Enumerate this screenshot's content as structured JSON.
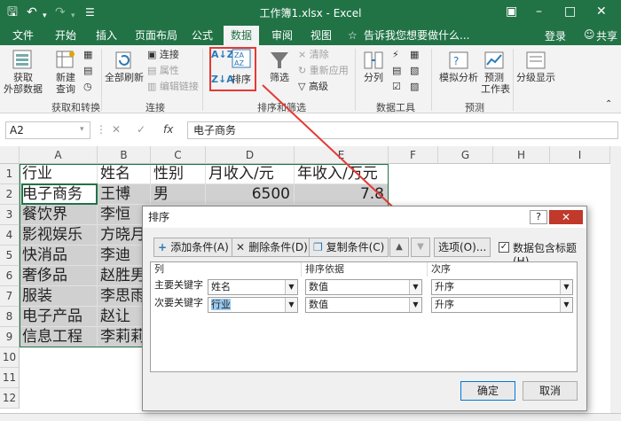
{
  "titlebar": {
    "title": "工作簿1.xlsx - Excel"
  },
  "tabs": [
    "文件",
    "开始",
    "插入",
    "页面布局",
    "公式",
    "数据",
    "审阅",
    "视图"
  ],
  "tellme": "告诉我您想要做什么...",
  "login": "登录",
  "share": "共享",
  "ribbon": {
    "get_external": "获取\n外部数据",
    "new_query": "新建\n查询",
    "grp_get": "获取和转换",
    "refresh_all": "全部刷新",
    "connections": "连接",
    "properties": "属性",
    "edit_links": "编辑链接",
    "grp_conn": "连接",
    "sort": "排序",
    "filter": "筛选",
    "clear": "清除",
    "reapply": "重新应用",
    "advanced": "高级",
    "grp_sort": "排序和筛选",
    "text_to_cols": "分列",
    "grp_tools": "数据工具",
    "what_if": "模拟分析",
    "forecast_sheet": "预测\n工作表",
    "grp_forecast": "预测",
    "outline": "分级显示"
  },
  "formula": {
    "namebox": "A2",
    "fx": "fx",
    "content": "电子商务"
  },
  "columns": [
    "A",
    "B",
    "C",
    "D",
    "E",
    "F",
    "G",
    "H",
    "I"
  ],
  "rows": [
    "1",
    "2",
    "3",
    "4",
    "5",
    "6",
    "7",
    "8",
    "9",
    "10",
    "11",
    "12"
  ],
  "table": {
    "header": [
      "行业",
      "姓名",
      "性别",
      "月收入/元",
      "年收入/万元"
    ],
    "col_a": [
      "电子商务",
      "餐饮界",
      "影视娱乐",
      "快消品",
      "奢侈品",
      "服装",
      "电子产品",
      "信息工程"
    ],
    "col_b": [
      "王博",
      "李恒",
      "方晓月",
      "李迪",
      "赵胜男",
      "李思雨",
      "赵让",
      "李莉莉"
    ],
    "row2_c": "男",
    "row2_d": "6500",
    "row2_e": "7.8"
  },
  "dialog": {
    "title": "排序",
    "help": "?",
    "add_level": "添加条件(A)",
    "delete_level": "删除条件(D)",
    "copy_level": "复制条件(C)",
    "options": "选项(O)...",
    "has_headers": "数据包含标题(H)",
    "hdr_col": "列",
    "hdr_sorton": "排序依据",
    "hdr_order": "次序",
    "row1_label": "主要关键字",
    "row1_col": "姓名",
    "row1_sorton": "数值",
    "row1_order": "升序",
    "row2_label": "次要关键字",
    "row2_col": "行业",
    "row2_sorton": "数值",
    "row2_order": "升序",
    "ok": "确定",
    "cancel": "取消"
  },
  "colors": {
    "brand": "#217346",
    "highlight_box": "#e53935",
    "arrow": "#e53935"
  }
}
